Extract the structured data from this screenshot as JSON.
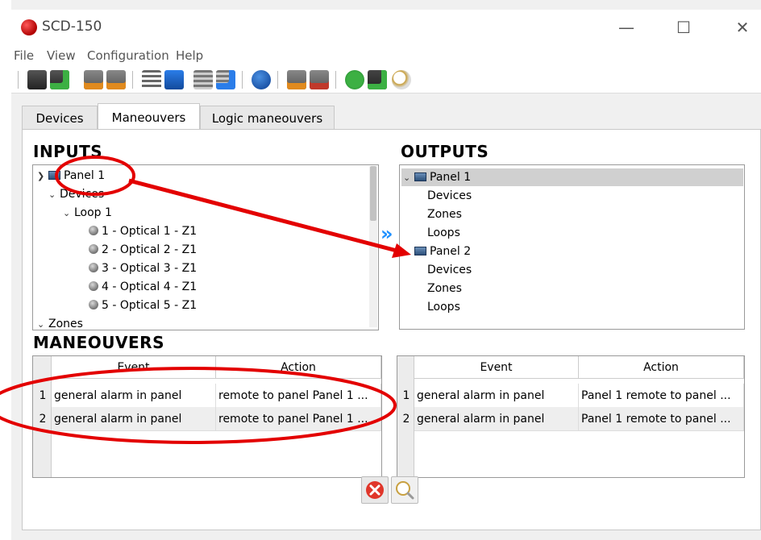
{
  "window": {
    "title": "SCD-150",
    "minimize": "—",
    "maximize": "☐",
    "close": "✕"
  },
  "menu": {
    "file": "File",
    "view": "View",
    "configuration": "Configuration",
    "help": "Help"
  },
  "tabs": [
    "Devices",
    "Maneouvers",
    "Logic maneouvers"
  ],
  "inputs": {
    "title": "INPUTS",
    "panel": "Panel 1",
    "devices": "Devices",
    "loop": "Loop 1",
    "items": [
      "1 - Optical 1 - Z1",
      "2 - Optical 2 - Z1",
      "3 - Optical 3 - Z1",
      "4 - Optical 4 - Z1",
      "5 - Optical 5 - Z1"
    ],
    "zones": "Zones"
  },
  "outputs": {
    "title": "OUTPUTS",
    "panel1": "Panel 1",
    "panel2": "Panel 2",
    "p1_children": [
      "Devices",
      "Zones",
      "Loops"
    ],
    "p2_children": [
      "Devices",
      "Zones",
      "Loops"
    ]
  },
  "transfer_glyph": "»",
  "maneouvers": {
    "title": "MANEOUVERS",
    "left": {
      "headers": [
        "Event",
        "Action"
      ],
      "rows": [
        {
          "num": "1",
          "event": "general alarm in panel",
          "action": "remote to panel Panel 1 ..."
        },
        {
          "num": "2",
          "event": "general alarm in panel",
          "action": "remote to panel Panel 1 ..."
        }
      ]
    },
    "right": {
      "headers": [
        "Event",
        "Action"
      ],
      "rows": [
        {
          "num": "1",
          "event": "general alarm in panel",
          "action": "Panel 1  remote to panel ..."
        },
        {
          "num": "2",
          "event": "general alarm in panel",
          "action": "Panel 1  remote to panel ..."
        }
      ]
    }
  },
  "colors": {
    "annotation": "#e30000",
    "accent_blue": "#1e90ff",
    "delete_red": "#e0362a"
  },
  "icons": [
    "save-icon",
    "save-as-icon",
    "csv-export-icon",
    "csv-import-icon",
    "add-list-icon",
    "add-blue-icon",
    "list-icon",
    "list-add-icon",
    "globe-icon",
    "csv-icon",
    "txt-icon",
    "refresh-icon",
    "clipboard-icon",
    "search-icon",
    "delete-icon",
    "zoom-icon"
  ]
}
